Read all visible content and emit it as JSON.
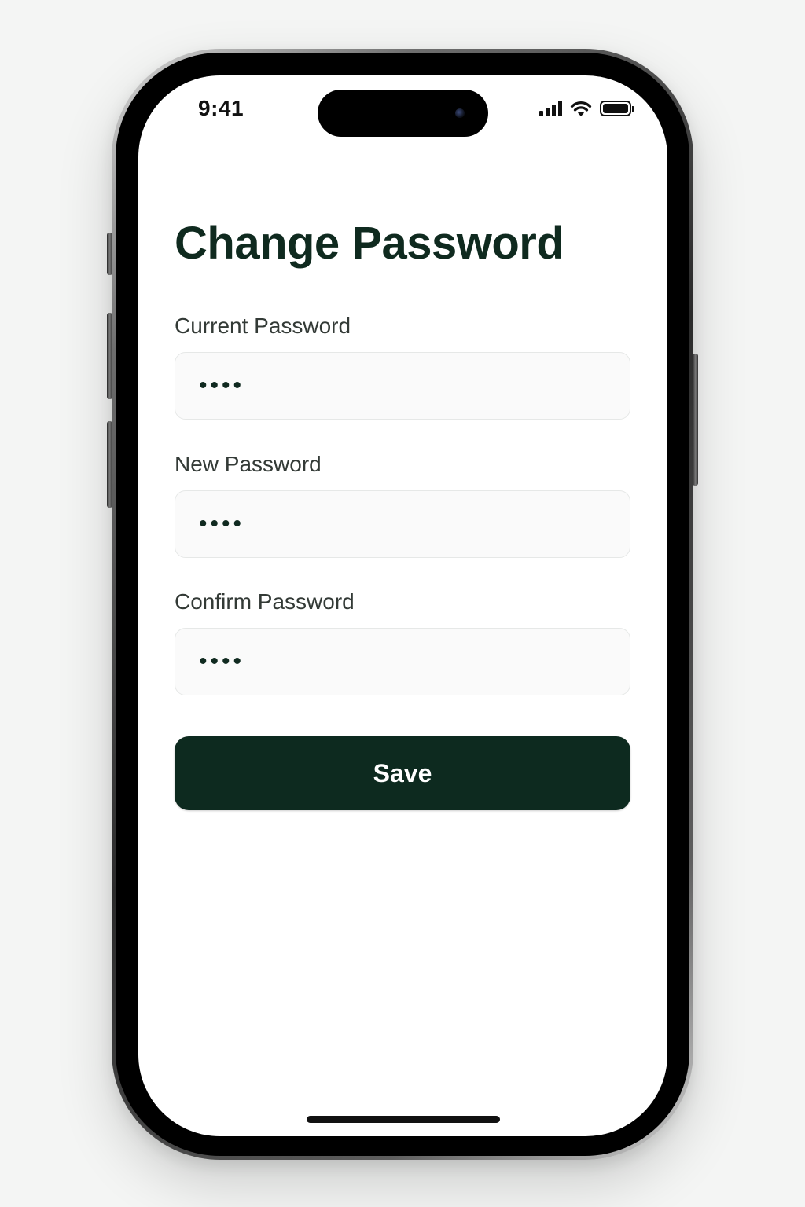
{
  "status_bar": {
    "time": "9:41",
    "icons": [
      "cellular-signal-icon",
      "wifi-icon",
      "battery-icon"
    ]
  },
  "page": {
    "title": "Change Password"
  },
  "form": {
    "fields": [
      {
        "label": "Current Password",
        "value": "••••"
      },
      {
        "label": "New Password",
        "value": "••••"
      },
      {
        "label": "Confirm Password",
        "value": "••••"
      }
    ],
    "save_label": "Save"
  },
  "colors": {
    "accent": "#0d2a1f",
    "title": "#0f2a1f",
    "input_background": "#fafafa",
    "input_border": "#e6e8e7",
    "screen_background": "#ffffff"
  }
}
